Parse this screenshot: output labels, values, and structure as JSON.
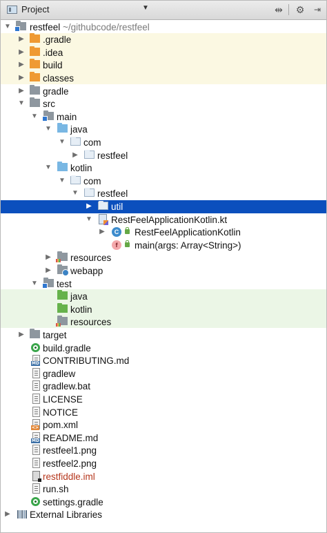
{
  "header": {
    "title": "Project",
    "dropdown_icon": "triangle-down-icon",
    "buttons": [
      "scroll-from-source-icon",
      "gear-icon",
      "hide-icon"
    ]
  },
  "colors": {
    "selection": "#0b4fbd",
    "excluded_band": "#fbf8e2",
    "test_band": "#ebf6e6"
  },
  "tree": [
    {
      "label": "restfeel",
      "path": " ~/githubcode/restfeel",
      "icon": "module-folder-icon",
      "expanded": true
    },
    {
      "label": ".gradle",
      "icon": "folder-icon",
      "expanded": false
    },
    {
      "label": ".idea",
      "icon": "folder-icon",
      "expanded": false
    },
    {
      "label": "build",
      "icon": "folder-icon",
      "expanded": false
    },
    {
      "label": "classes",
      "icon": "folder-icon",
      "expanded": false
    },
    {
      "label": "gradle",
      "icon": "folder-icon",
      "expanded": false
    },
    {
      "label": "src",
      "icon": "folder-icon",
      "expanded": true
    },
    {
      "label": "main",
      "icon": "module-folder-icon",
      "expanded": true
    },
    {
      "label": "java",
      "icon": "source-folder-icon",
      "expanded": true
    },
    {
      "label": "com",
      "icon": "package-icon",
      "expanded": true
    },
    {
      "label": "restfeel",
      "icon": "package-icon",
      "expanded": false
    },
    {
      "label": "kotlin",
      "icon": "source-folder-icon",
      "expanded": true
    },
    {
      "label": "com",
      "icon": "package-icon",
      "expanded": true
    },
    {
      "label": "restfeel",
      "icon": "package-icon",
      "expanded": true
    },
    {
      "label": "util",
      "icon": "package-icon",
      "expanded": false,
      "selected": true
    },
    {
      "label": "RestFeelApplicationKotlin.kt",
      "icon": "kotlin-file-icon",
      "expanded": true
    },
    {
      "label": "RestFeelApplicationKotlin",
      "icon": "class-icon",
      "expanded": false
    },
    {
      "label": "main(args: Array<String>)",
      "icon": "function-icon"
    },
    {
      "label": "resources",
      "icon": "resources-folder-icon",
      "expanded": false
    },
    {
      "label": "webapp",
      "icon": "web-folder-icon",
      "expanded": false
    },
    {
      "label": "test",
      "icon": "module-folder-icon",
      "expanded": true
    },
    {
      "label": "java",
      "icon": "test-folder-icon"
    },
    {
      "label": "kotlin",
      "icon": "test-folder-icon"
    },
    {
      "label": "resources",
      "icon": "test-resources-folder-icon"
    },
    {
      "label": "target",
      "icon": "folder-icon",
      "expanded": false
    },
    {
      "label": "build.gradle",
      "icon": "gradle-icon"
    },
    {
      "label": "CONTRIBUTING.md",
      "icon": "markdown-file-icon",
      "badge": "MD"
    },
    {
      "label": "gradlew",
      "icon": "text-file-icon"
    },
    {
      "label": "gradlew.bat",
      "icon": "text-file-icon"
    },
    {
      "label": "LICENSE",
      "icon": "text-file-icon"
    },
    {
      "label": "NOTICE",
      "icon": "text-file-icon"
    },
    {
      "label": "pom.xml",
      "icon": "xml-file-icon",
      "badge": "<>"
    },
    {
      "label": "README.md",
      "icon": "markdown-file-icon",
      "badge": "MD"
    },
    {
      "label": "restfeel1.png",
      "icon": "text-file-icon"
    },
    {
      "label": "restfeel2.png",
      "icon": "text-file-icon"
    },
    {
      "label": "restfiddle.iml",
      "icon": "iml-file-icon"
    },
    {
      "label": "run.sh",
      "icon": "text-file-icon"
    },
    {
      "label": "settings.gradle",
      "icon": "gradle-icon"
    },
    {
      "label": "External Libraries",
      "icon": "libraries-icon",
      "expanded": false
    }
  ]
}
